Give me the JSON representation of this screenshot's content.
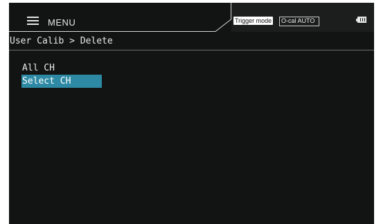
{
  "header": {
    "menu_label": "MENU",
    "menu_icon": "hamburger-icon",
    "status": {
      "trigger_mode_label": "Trigger mode",
      "ocal_label": "O-cal AUTO",
      "battery_icon": "battery-icon"
    }
  },
  "breadcrumb": {
    "text": "User Calib > Delete"
  },
  "options": [
    {
      "label": "All CH",
      "selected": false
    },
    {
      "label": "Select CH",
      "selected": true
    }
  ],
  "colors": {
    "background": "#121414",
    "selection": "#2e8aa4",
    "text": "#e8e8e8"
  }
}
